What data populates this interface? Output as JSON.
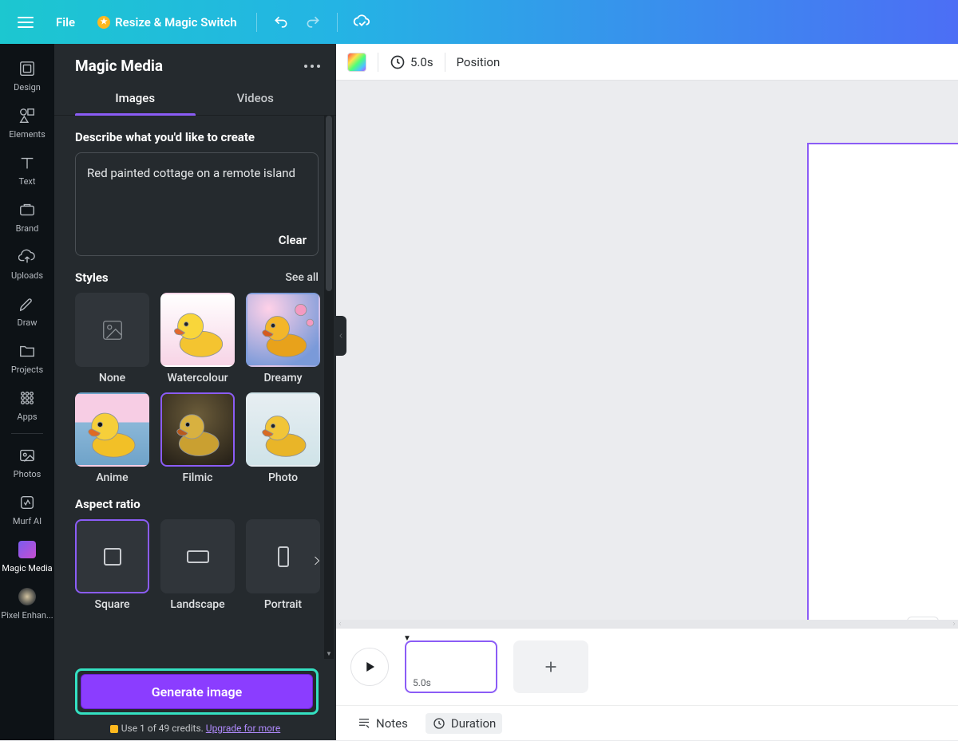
{
  "topbar": {
    "file": "File",
    "resize": "Resize & Magic Switch"
  },
  "rail": {
    "items": [
      {
        "label": "Design"
      },
      {
        "label": "Elements"
      },
      {
        "label": "Text"
      },
      {
        "label": "Brand"
      },
      {
        "label": "Uploads"
      },
      {
        "label": "Draw"
      },
      {
        "label": "Projects"
      },
      {
        "label": "Apps"
      }
    ],
    "extra": [
      {
        "label": "Photos"
      },
      {
        "label": "Murf AI"
      },
      {
        "label": "Magic Media"
      },
      {
        "label": "Pixel Enhan..."
      }
    ]
  },
  "panel": {
    "title": "Magic Media",
    "tabs": {
      "images": "Images",
      "videos": "Videos"
    },
    "describe_label": "Describe what you'd like to create",
    "prompt": "Red painted cottage on a remote island",
    "clear": "Clear",
    "styles_label": "Styles",
    "see_all": "See all",
    "styles": [
      {
        "label": "None"
      },
      {
        "label": "Watercolour"
      },
      {
        "label": "Dreamy"
      },
      {
        "label": "Anime"
      },
      {
        "label": "Filmic"
      },
      {
        "label": "Photo"
      }
    ],
    "aspect_label": "Aspect ratio",
    "aspects": [
      {
        "label": "Square"
      },
      {
        "label": "Landscape"
      },
      {
        "label": "Portrait"
      }
    ],
    "generate": "Generate image",
    "credits_prefix": "Use 1 of 49 credits. ",
    "credits_link": "Upgrade for more"
  },
  "canvas_toolbar": {
    "duration": "5.0s",
    "position": "Position"
  },
  "timeline": {
    "frame_time": "5.0s",
    "notes": "Notes",
    "duration": "Duration"
  }
}
